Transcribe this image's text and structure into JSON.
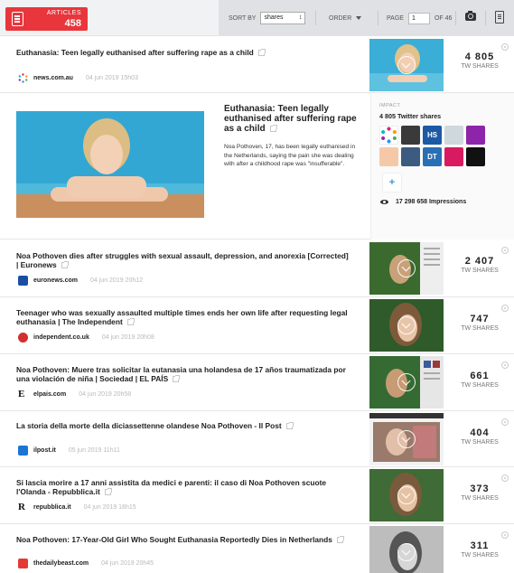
{
  "badge": {
    "label": "ARTICLES",
    "count": "458"
  },
  "controls": {
    "sort_by_label": "SORT BY",
    "sort_value": "shares",
    "order_label": "ORDER",
    "page_label": "PAGE",
    "page_value": "1",
    "page_of": "OF 46"
  },
  "shares_label": "TW SHARES",
  "articles": [
    {
      "title": "Euthanasia: Teen legally euthanised after suffering rape as a child",
      "source": "news.com.au",
      "date": "04 jun 2019 15h03",
      "shares": "4 805",
      "fav_color": "#e91e63"
    },
    {
      "title": "Noa Pothoven dies after struggles with sexual assault, depression, and anorexia [Corrected] | Euronews",
      "source": "euronews.com",
      "date": "04 jun 2019 20h12",
      "shares": "2 407",
      "fav_color": "#1b4ea3"
    },
    {
      "title": "Teenager who was sexually assaulted multiple times ends her own life after requesting legal euthanasia | The Independent",
      "source": "independent.co.uk",
      "date": "04 jun 2019 20h08",
      "shares": "747",
      "fav_color": "#d32f2f"
    },
    {
      "title": "Noa Pothoven: Muere tras solicitar la eutanasia una holandesa de 17 años traumatizada por una violación de niña | Sociedad | EL PAÍS",
      "source": "elpais.com",
      "date": "04 jun 2019 20h58",
      "shares": "661",
      "fav_color": "#111111"
    },
    {
      "title": "La storia della morte della diciassettenne olandese Noa Pothoven - Il Post",
      "source": "ilpost.it",
      "date": "05 jun 2019 11h11",
      "shares": "404",
      "fav_color": "#1976d2"
    },
    {
      "title": "Si lascia morire a 17 anni assistita da medici e parenti: il caso di Noa Pothoven scuote l'Olanda - Repubblica.it",
      "source": "repubblica.it",
      "date": "04 jun 2019 18h15",
      "shares": "373",
      "fav_color": "#111111"
    },
    {
      "title": "Noa Pothoven: 17-Year-Old Girl Who Sought Euthanasia Reportedly Dies in Netherlands",
      "source": "thedailybeast.com",
      "date": "04 jun 2019 20h45",
      "shares": "311",
      "fav_color": "#e53935"
    }
  ],
  "expanded": {
    "title": "Euthanasia: Teen legally euthanised after suffering rape as a child",
    "description": "Noa Pothoven, 17, has been legally euthanised in the Netherlands, saying the pain she was dealing with after a childhood rape was \"insufferable\".",
    "impact_label": "IMPACT",
    "twitter_shares": "4 805 Twitter shares",
    "impressions": "17 298 658 Impressions",
    "plus_label": "+",
    "avatars": [
      {
        "text": "",
        "color": "#ffffff"
      },
      {
        "text": "",
        "color": "#3a3a3a"
      },
      {
        "text": "HS",
        "color": "#1c5aa6"
      },
      {
        "text": "",
        "color": "#cfd8dc"
      },
      {
        "text": "",
        "color": "#8e24aa"
      },
      {
        "text": "",
        "color": "#f5c9a8"
      },
      {
        "text": "",
        "color": "#3d5a80"
      },
      {
        "text": "DT",
        "color": "#2a6fb5"
      },
      {
        "text": "",
        "color": "#d81b60"
      },
      {
        "text": "",
        "color": "#111111"
      }
    ]
  }
}
